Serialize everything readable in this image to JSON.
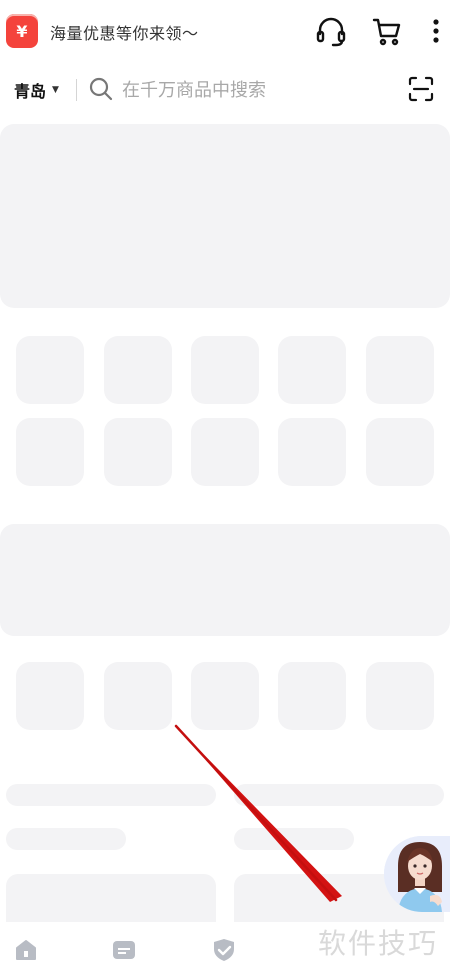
{
  "header": {
    "coupon_symbol": "¥",
    "promo_text": "海量优惠等你来领～",
    "icons": [
      "headset-icon",
      "cart-icon",
      "more-icon"
    ]
  },
  "search": {
    "city": "青岛",
    "placeholder": "在千万商品中搜索",
    "scan_icon": "scan-icon"
  },
  "bottom_nav": {
    "icons": [
      "home-icon",
      "message-icon",
      "shield-icon"
    ]
  },
  "watermark": "软件技巧",
  "colors": {
    "accent_red": "#f4433c",
    "skeleton": "#f3f3f5",
    "arrow": "#d31212"
  }
}
